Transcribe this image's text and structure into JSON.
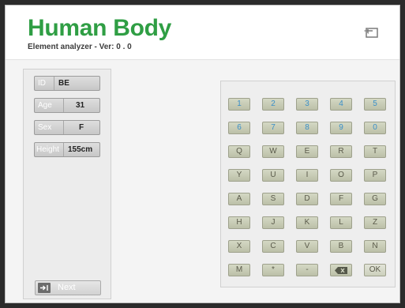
{
  "header": {
    "title": "Human Body",
    "subtitle": "Element analyzer - Ver:  0 . 0"
  },
  "info": {
    "rows": [
      {
        "label": "ID",
        "value": "BE"
      },
      {
        "label": "Age",
        "value": "31"
      },
      {
        "label": "Sex",
        "value": "F"
      },
      {
        "label": "Height",
        "value": "155cm"
      }
    ],
    "next_label": "Next"
  },
  "keypad": {
    "rows": [
      [
        "1",
        "2",
        "3",
        "4",
        "5"
      ],
      [
        "6",
        "7",
        "8",
        "9",
        "0"
      ],
      [
        "Q",
        "W",
        "E",
        "R",
        "T"
      ],
      [
        "Y",
        "U",
        "I",
        "O",
        "P"
      ],
      [
        "A",
        "S",
        "D",
        "F",
        "G"
      ],
      [
        "H",
        "J",
        "K",
        "L",
        "Z"
      ],
      [
        "X",
        "C",
        "V",
        "B",
        "N"
      ],
      [
        "M",
        "*",
        "-",
        "⌫",
        "OK"
      ]
    ]
  },
  "colors": {
    "accent": "#2f9e44",
    "numeric_key_text": "#3a8fc8"
  },
  "icons": {
    "exit": "exit-door-icon",
    "next": "enter-arrow-icon",
    "backspace": "backspace-icon"
  }
}
